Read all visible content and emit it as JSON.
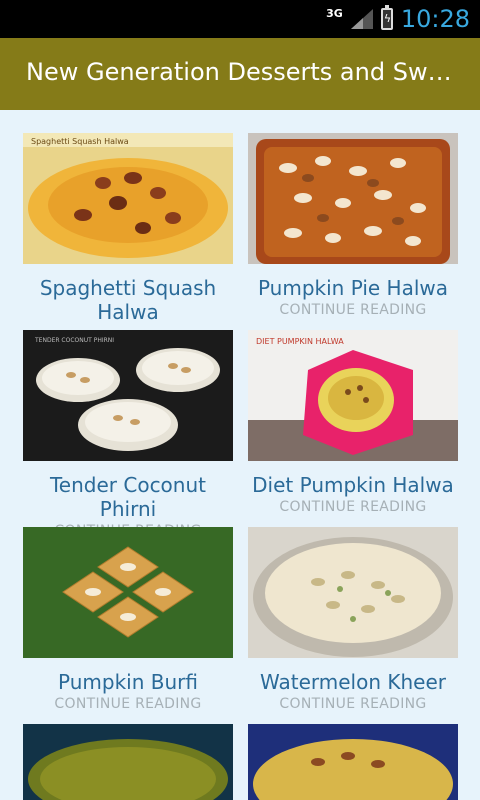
{
  "status_bar": {
    "network": "3G",
    "time": "10:28",
    "icons": [
      "signal-icon",
      "battery-charging-icon"
    ]
  },
  "app_bar": {
    "title": "New Generation Desserts and Sw…"
  },
  "recipes": [
    {
      "title": "Spaghetti Squash Halwa",
      "continue": "",
      "image_caption": "Spaghetti Squash Halwa"
    },
    {
      "title": "Pumpkin Pie Halwa",
      "continue": "CONTINUE READING"
    },
    {
      "title": "Tender Coconut Phirni",
      "continue": "CONTINUE READING",
      "image_caption": "TENDER COCONUT PHIRNI"
    },
    {
      "title": "Diet Pumpkin Halwa",
      "continue": "CONTINUE READING",
      "image_caption": "DIET PUMPKIN HALWA"
    },
    {
      "title": "Pumpkin Burfi",
      "continue": "CONTINUE READING"
    },
    {
      "title": "Watermelon Kheer",
      "continue": "CONTINUE READING"
    }
  ]
}
